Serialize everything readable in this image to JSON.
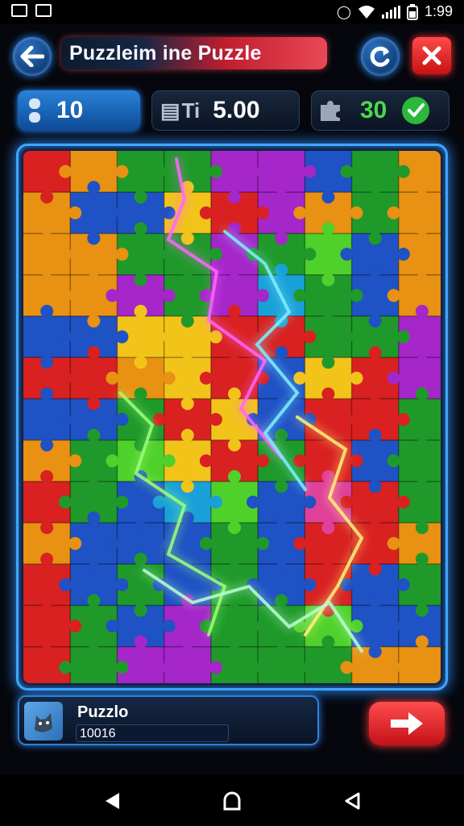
{
  "status_bar": {
    "time": "1:99",
    "icons": [
      "notification-icon",
      "image-icon",
      "vibrate-icon",
      "wifi-icon",
      "signal-icon",
      "battery-icon"
    ]
  },
  "header": {
    "back_icon": "arrow-left-icon",
    "title": "Puzzleim ine Puzzle",
    "restart_icon": "restart-icon",
    "close_icon": "close-icon"
  },
  "stats": {
    "moves": {
      "icon": "pause-icon",
      "value": "10"
    },
    "time": {
      "icon": "timer-icon",
      "label": "Ti",
      "value": "5.00"
    },
    "pieces": {
      "icon": "puzzle-piece-icon",
      "value": "30",
      "check_icon": "check-icon"
    }
  },
  "board": {
    "columns": 9,
    "rows": 13,
    "palette": {
      "r": "#d92121",
      "o": "#e89112",
      "y": "#f2c41a",
      "g": "#1f9a2a",
      "l": "#4fd02a",
      "b": "#1f52c4",
      "c": "#1aa0d8",
      "p": "#a526c9",
      "k": "#e0409a"
    },
    "grid": [
      "roggppbgo",
      "obbyrpogo",
      "ooggpglbo",
      "oopgpcgbo",
      "bbyyrrggp",
      "rroyrbyrp",
      "bbgrybrrg",
      "oglyrgrbg",
      "rgbclbkrg",
      "obbbgbrro",
      "rbgbgbrbg",
      "rgbpgglbb",
      "rgppgggoo"
    ]
  },
  "footer": {
    "card": {
      "thumb_icon": "cat-icon",
      "name": "Puzzlo",
      "value": "10016"
    },
    "next_icon": "arrow-right-icon"
  },
  "navbar": [
    "back-nav-icon",
    "home-nav-icon",
    "recent-nav-icon"
  ]
}
